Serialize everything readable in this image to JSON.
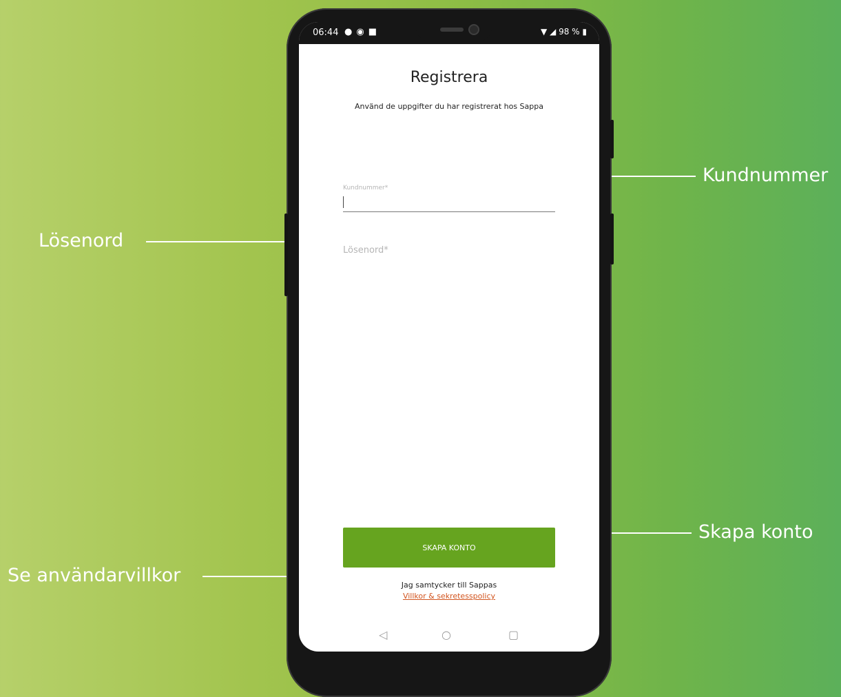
{
  "callouts": {
    "kundnummer": "Kundnummer",
    "losenord": "Lösenord",
    "skapa_konto": "Skapa konto",
    "anvandarvillkor": "Se användarvillkor"
  },
  "status_bar": {
    "time": "06:44",
    "battery": "98 %",
    "left_icons": [
      "location-pin-icon",
      "notification-icon",
      "image-icon"
    ],
    "right_icons": [
      "wifi-icon",
      "signal-icon",
      "battery-icon"
    ]
  },
  "screen": {
    "title": "Registrera",
    "subtitle": "Använd de uppgifter du har registrerat hos Sappa",
    "customer_number_label": "Kundnummer*",
    "customer_number_value": "",
    "password_label": "Lösenord*",
    "create_button": "SKAPA KONTO",
    "consent_text": "Jag samtycker till Sappas",
    "terms_link": "Villkor & sekretesspolicy"
  },
  "nav": {
    "back": "◁",
    "home": "○",
    "recents": "▢"
  },
  "colors": {
    "accent": "#66a41f",
    "link": "#d2541e",
    "background_left": "#b6d06a",
    "background_right": "#5cb05a"
  }
}
